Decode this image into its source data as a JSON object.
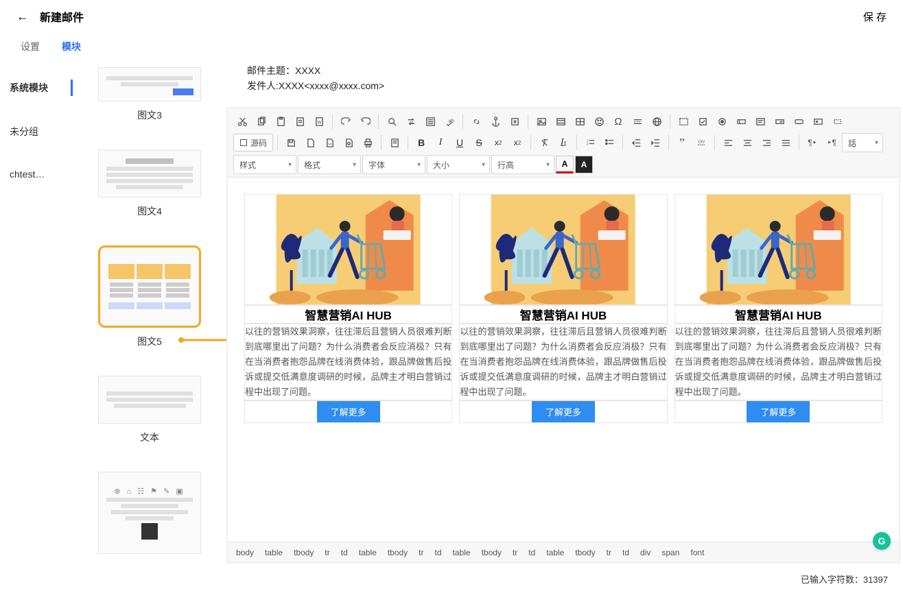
{
  "header": {
    "title": "新建邮件",
    "save": "保 存"
  },
  "tabs": {
    "settings": "设置",
    "modules": "模块"
  },
  "categories": {
    "system": "系统模块",
    "ungrouped": "未分组",
    "chtest": "chtest…"
  },
  "modules": {
    "m3": "图文3",
    "m4": "图文4",
    "m5": "图文5",
    "text": "文本"
  },
  "meta": {
    "subject_label": "邮件主题：",
    "subject_value": "XXXX",
    "from_label": "发件人:",
    "from_value": "XXXX<xxxx@xxxx.com>"
  },
  "toolbar": {
    "source": "源码",
    "style": "样式",
    "format": "格式",
    "font": "字体",
    "size": "大小",
    "lineheight": "行高",
    "lang": "話"
  },
  "cards": [
    {
      "title": "智慧营销AI HUB",
      "body": "以往的营销效果洞察，往往滞后且营销人员很难判断到底哪里出了问题？为什么消费者会反应消极？只有在当消费者抱怨品牌在线消费体验，跟品牌做售后投诉或提交低满意度调研的时候，品牌主才明白营销过程中出现了问题。",
      "button": "了解更多"
    },
    {
      "title": "智慧营销AI HUB",
      "body": "以往的营销效果洞察，往往滞后且营销人员很难判断到底哪里出了问题？为什么消费者会反应消极？只有在当消费者抱怨品牌在线消费体验，跟品牌做售后投诉或提交低满意度调研的时候，品牌主才明白营销过程中出现了问题。",
      "button": "了解更多"
    },
    {
      "title": "智慧营销AI HUB",
      "body": "以往的营销效果洞察，往往滞后且营销人员很难判断到底哪里出了问题？为什么消费者会反应消极？只有在当消费者抱怨品牌在线消费体验，跟品牌做售后投诉或提交低满意度调研的时候，品牌主才明白营销过程中出现了问题。",
      "button": "了解更多"
    }
  ],
  "path": [
    "body",
    "table",
    "tbody",
    "tr",
    "td",
    "table",
    "tbody",
    "tr",
    "td",
    "table",
    "tbody",
    "tr",
    "td",
    "table",
    "tbody",
    "tr",
    "td",
    "div",
    "span",
    "font"
  ],
  "counter": {
    "label": "已输入字符数：",
    "value": "31397"
  },
  "colors": {
    "accent": "#2f6ef0",
    "highlight": "#f5a623",
    "btn": "#2f8cf0"
  }
}
